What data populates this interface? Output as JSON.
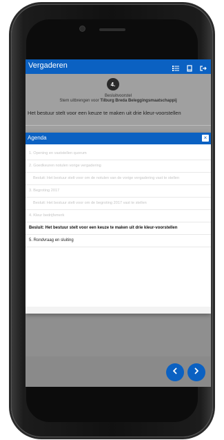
{
  "app": {
    "title": "Vergaderen",
    "icons": [
      "list-icon",
      "book-icon",
      "logout-icon"
    ]
  },
  "item": {
    "number": "4.",
    "type_label": "Besluitvoorstel",
    "vote_prefix": "Stem uitbrengen voor",
    "company": "Tilburg Breda Beleggingsmaatschappij",
    "proposal": "Het bestuur stelt voor een keuze te maken uit drie kleur-voorstellen"
  },
  "modal": {
    "title": "Agenda",
    "close": "×",
    "items": [
      {
        "text": "1. Opening en vaststellen quorum",
        "style": "faded"
      },
      {
        "text": "2. Goedkeuren notulen vorige vergadering",
        "style": "faded"
      },
      {
        "text": "Besluit: Het bestuur stelt voor om de notulen van de vorige vergadering vast te stellen",
        "style": "faded-indent"
      },
      {
        "text": "3. Begroting 2017",
        "style": "faded"
      },
      {
        "text": "Besluit: Het bestuur stelt voor om de begroting 2017 vast te stellen",
        "style": "faded-indent"
      },
      {
        "text": "4. Kleur bedrijfsmerk",
        "style": "faded"
      },
      {
        "text": "Besluit: Het bestuur stelt voor een keuze te maken uit drie kleur-voorstellen",
        "style": "bold"
      },
      {
        "text": "5. Rondvraag en sluiting",
        "style": "normal"
      }
    ]
  },
  "nav": {
    "prev_icon": "chevron-left-icon",
    "next_icon": "chevron-right-icon"
  },
  "colors": {
    "accent": "#0b61c2",
    "overlay": "#8f8f8f"
  }
}
